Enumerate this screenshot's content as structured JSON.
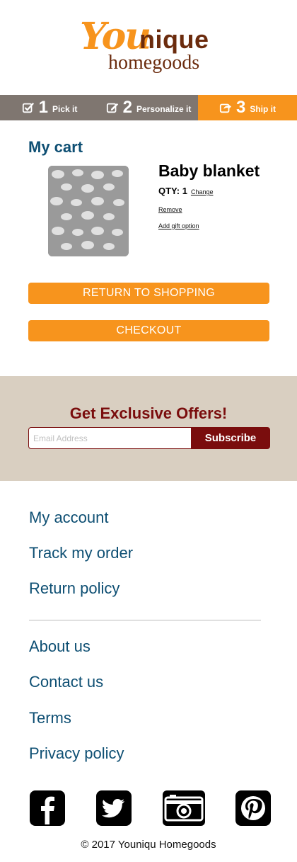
{
  "logo": {
    "part1": "You",
    "part2": "nique",
    "part3": "homegoods"
  },
  "steps": [
    {
      "num": "1",
      "label": "Pick it",
      "icon": "checkbox-icon"
    },
    {
      "num": "2",
      "label": "Personalize it",
      "icon": "edit-icon"
    },
    {
      "num": "3",
      "label": "Ship it",
      "icon": "share-icon"
    }
  ],
  "cart": {
    "title": "My cart",
    "item": {
      "name": "Baby blanket",
      "qty_label": "QTY: 1",
      "change": "Change",
      "remove": "Remove",
      "gift": "Add gift option"
    },
    "return_label": "RETURN TO SHOPPING",
    "checkout_label": "CHECKOUT"
  },
  "offers": {
    "title": "Get Exclusive Offers!",
    "placeholder": "Email Address",
    "subscribe": "Subscribe"
  },
  "footer": {
    "links_group1": [
      "My account",
      "Track my order",
      "Return policy"
    ],
    "links_group2": [
      "About us",
      "Contact us",
      "Terms",
      "Privacy policy"
    ],
    "social": [
      "facebook-icon",
      "twitter-icon",
      "camera-icon",
      "pinterest-icon"
    ],
    "copyright": "© 2017 Youniqu Homegoods"
  },
  "colors": {
    "accent": "#f7941d",
    "brand_brown": "#6b2b0d",
    "steps_gray": "#7f7670",
    "link_blue": "#0e4f73",
    "offers_bg": "#d9cfc1",
    "offers_red": "#7a0d0d"
  }
}
